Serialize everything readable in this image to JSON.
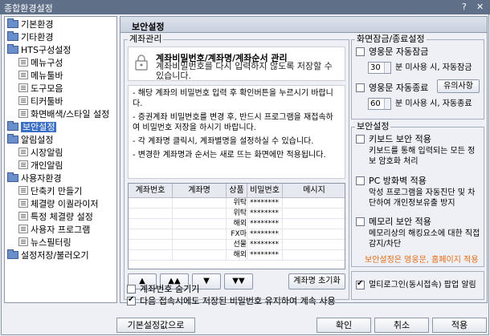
{
  "window": {
    "title": "종합환경설정",
    "help": "?",
    "close": "✕"
  },
  "sidebar": {
    "items": [
      {
        "label": "기본환경"
      },
      {
        "label": "기타환경"
      },
      {
        "label": "HTS구성설정"
      },
      {
        "label": "메뉴구성"
      },
      {
        "label": "메뉴툴바"
      },
      {
        "label": "도구모음"
      },
      {
        "label": "티커툴바"
      },
      {
        "label": "화면배색/스타일 설정"
      },
      {
        "label": "보안설정"
      },
      {
        "label": "알림설정"
      },
      {
        "label": "시장알림"
      },
      {
        "label": "개인알림"
      },
      {
        "label": "사용자환경"
      },
      {
        "label": "단축키 만들기"
      },
      {
        "label": "체결량 이퀄라이저"
      },
      {
        "label": "특정 체결량 설정"
      },
      {
        "label": "사용자 프로그램"
      },
      {
        "label": "뉴스필터링"
      },
      {
        "label": "설정저장/불러오기"
      }
    ]
  },
  "main": {
    "header": "보안설정",
    "account": {
      "group_title": "계좌관리",
      "notice_title": "계좌비밀번호/계좌명/계좌순서 관리",
      "notice_desc": "계좌비밀번호를 다시 입력하지 않도록 저장할 수 있습니다.",
      "bullets": [
        "- 해당 계좌의 비밀번호 입력 후 확인버튼을 누르시기 바랍니다.",
        "- 증권계좌 비밀번호를 변경 후, 반드시 프로그램을 재접속하여 비밀번호 저장을 하시기 바랍니다.",
        "- 각 계좌명 클릭시, 계좌별명을 설정하실 수 있습니다.",
        "- 변경한 계좌명과 순서는 새로 뜨는 화면에만 적용됩니다."
      ],
      "columns": [
        "계좌번호",
        "계좌명",
        "상품",
        "비밀번호",
        "메시지"
      ],
      "rows": [
        {
          "product": "위탁",
          "password": "********"
        },
        {
          "product": "위탁",
          "password": "********"
        },
        {
          "product": "해외",
          "password": "********"
        },
        {
          "product": "FX마",
          "password": "********"
        },
        {
          "product": "선물",
          "password": "********"
        },
        {
          "product": "해외",
          "password": "********"
        }
      ],
      "move_buttons": [
        "▲",
        "▲▲",
        "▼",
        "▼▼"
      ],
      "reset_names_button": "계좌명 초기화",
      "hide_account_label": "계좌번호 숨기기",
      "keep_password_label": "다음 접속시에도 저장된 비밀번호 유지하여 계속 사용"
    },
    "lock_settings": {
      "group_title": "화면잠금/종료설정",
      "auto_lock_label": "영웅문 자동잠금",
      "auto_lock_minutes": "30",
      "auto_lock_desc": "분 미사용 시, 자동잠금",
      "auto_exit_label": "영웅문 자동종료",
      "notice_button": "유의사항",
      "auto_exit_minutes": "60",
      "auto_exit_desc": "분 미사용 시, 자동종료"
    },
    "security": {
      "group_title": "보안설정",
      "keyboard_label": "키보드 보안 적용",
      "keyboard_desc": "키보드를 통해 입력되는 모든 정보 암호화 처리",
      "firewall_label": "PC 방화벽 적용",
      "firewall_desc": "악성 프로그램을 자동진단 및 차단하여 개인정보유출 방지",
      "memory_label": "메모리 보안 적용",
      "memory_desc": "메모리상의 해킹요소에 대한 직접 감지/차단",
      "footer_note": "보안설정은 영웅문, 홈페이지 적용"
    },
    "multi_login_label": "멀티로그인(동시접속) 팝업 알림"
  },
  "footer": {
    "defaults_button": "기본설정값으로",
    "ok_button": "확인",
    "cancel_button": "취소",
    "apply_button": "적용"
  }
}
